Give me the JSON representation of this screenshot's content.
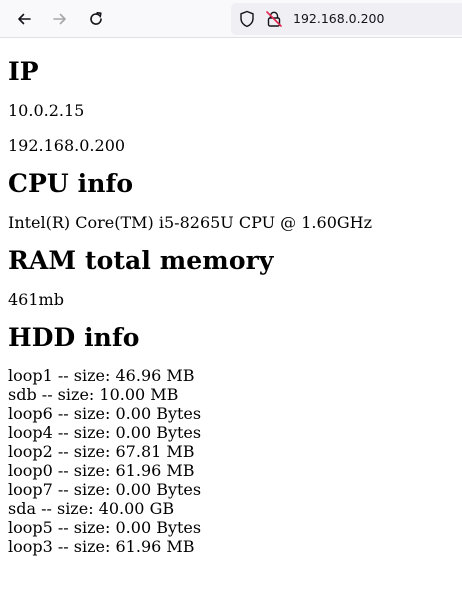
{
  "browser": {
    "url": "192.168.0.200"
  },
  "page": {
    "ip_heading": "IP",
    "ip_addresses": [
      "10.0.2.15",
      "192.168.0.200"
    ],
    "cpu_heading": "CPU info",
    "cpu_model": "Intel(R) Core(TM) i5-8265U CPU @ 1.60GHz",
    "ram_heading": "RAM total memory",
    "ram_total": "461mb",
    "hdd_heading": "HDD info",
    "hdd_lines": [
      "loop1 -- size: 46.96 MB",
      "sdb -- size: 10.00 MB",
      "loop6 -- size: 0.00 Bytes",
      "loop4 -- size: 0.00 Bytes",
      "loop2 -- size: 67.81 MB",
      "loop0 -- size: 61.96 MB",
      "loop7 -- size: 0.00 Bytes",
      "sda -- size: 40.00 GB",
      "loop5 -- size: 0.00 Bytes",
      "loop3 -- size: 61.96 MB"
    ]
  }
}
